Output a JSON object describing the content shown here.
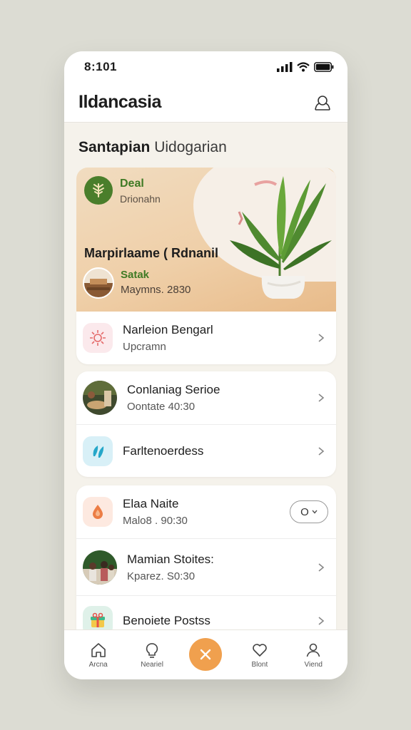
{
  "status_bar": {
    "time": "8:101"
  },
  "app_bar": {
    "title": "Ildancasia",
    "profile_icon": "profile-icon"
  },
  "section": {
    "title_bold": "Santapian",
    "title_regular": "Uidogarian"
  },
  "hero": {
    "deal_label": "Deal",
    "deal_sub": "Drionahn",
    "headline": "Marpirlaame ( Rdnanil",
    "tag": "Satak",
    "meta": "Maymns. 2830",
    "colors": {
      "deal_green": "#3f7a24",
      "badge_green": "#4a7e2b",
      "sand": "#efcfa8"
    }
  },
  "group1": [
    {
      "title": "Narleion Bengarl",
      "subtitle": "Upcramn",
      "icon": "sun-flower-icon"
    }
  ],
  "group2": [
    {
      "title": "Conlaniag Serioe",
      "subtitle": "Oontate 40:30",
      "icon": "cafe-photo"
    },
    {
      "title": "Farltenoerdess",
      "subtitle": "",
      "icon": "leaf-icon"
    }
  ],
  "group3": [
    {
      "title": "Elaa Naite",
      "subtitle": "Malo8 . 90:30",
      "icon": "drop-icon",
      "control": "O"
    },
    {
      "title": "Mamian Stoites:",
      "subtitle": "Kparez. S0:30",
      "icon": "people-photo"
    },
    {
      "title": "Benoiete Postss",
      "subtitle": "",
      "icon": "gift-icon"
    }
  ],
  "tab_bar": {
    "tabs": [
      {
        "label": "Arcna",
        "icon": "home-icon"
      },
      {
        "label": "Neariel",
        "icon": "bulb-icon"
      },
      {
        "label": "",
        "icon": "close-icon"
      },
      {
        "label": "Blont",
        "icon": "heart-icon"
      },
      {
        "label": "Viend",
        "icon": "user-icon"
      }
    ],
    "accent": "#f0a04e"
  }
}
